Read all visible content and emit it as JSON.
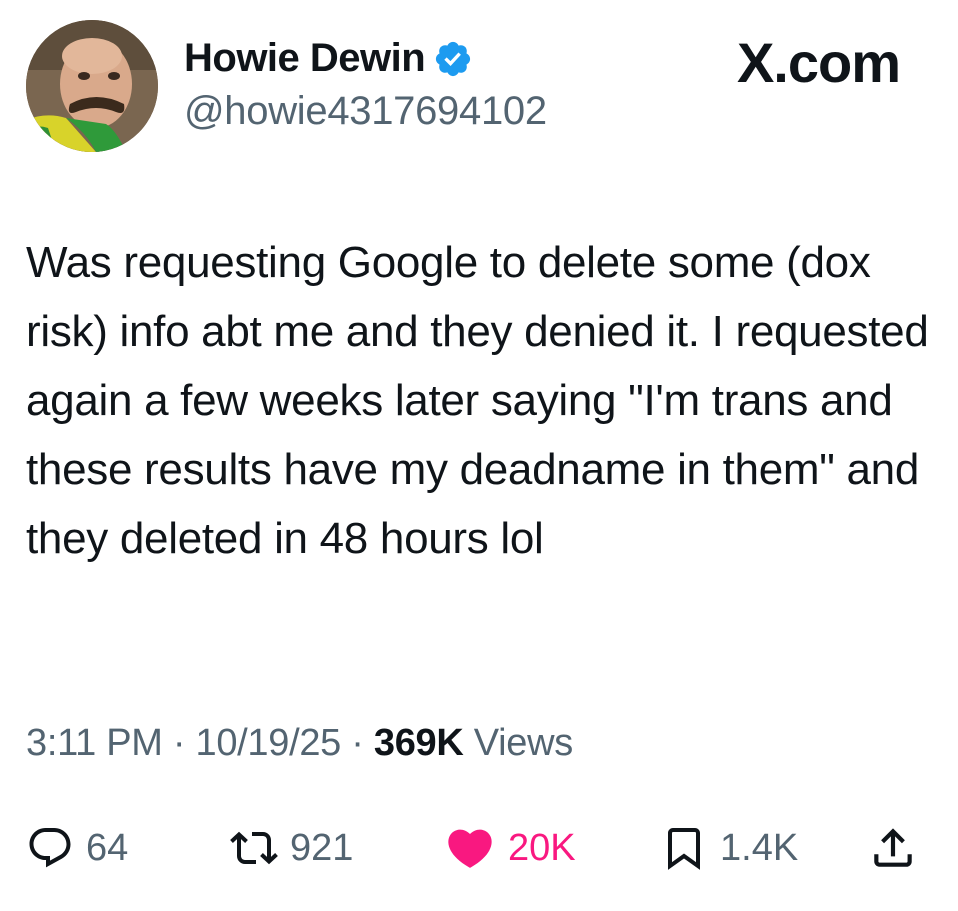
{
  "author": {
    "display_name": "Howie Dewin",
    "handle": "@howie4317694102",
    "verified": true,
    "verified_color": "#1d9bf0"
  },
  "brand": {
    "label": "X.com"
  },
  "tweet": {
    "text": "Was requesting Google to delete some (dox risk) info abt me and they denied it. I requested again a few weeks later saying \"I'm trans and these results have my deadname in them\" and they deleted in 48 hours lol"
  },
  "meta": {
    "time": "3:11 PM",
    "sep1": " · ",
    "date": "10/19/25",
    "sep2": " · ",
    "views_count": "369K",
    "views_label": " Views"
  },
  "actions": {
    "reply": {
      "icon": "reply-icon",
      "count": "64"
    },
    "retweet": {
      "icon": "retweet-icon",
      "count": "921"
    },
    "like": {
      "icon": "heart-icon",
      "count": "20K",
      "color": "#f91880",
      "liked": true
    },
    "bookmark": {
      "icon": "bookmark-icon",
      "count": "1.4K"
    },
    "share": {
      "icon": "share-icon"
    }
  },
  "colors": {
    "text_primary": "#0f1419",
    "text_secondary": "#536471",
    "like_pink": "#f91880",
    "verified_blue": "#1d9bf0"
  }
}
